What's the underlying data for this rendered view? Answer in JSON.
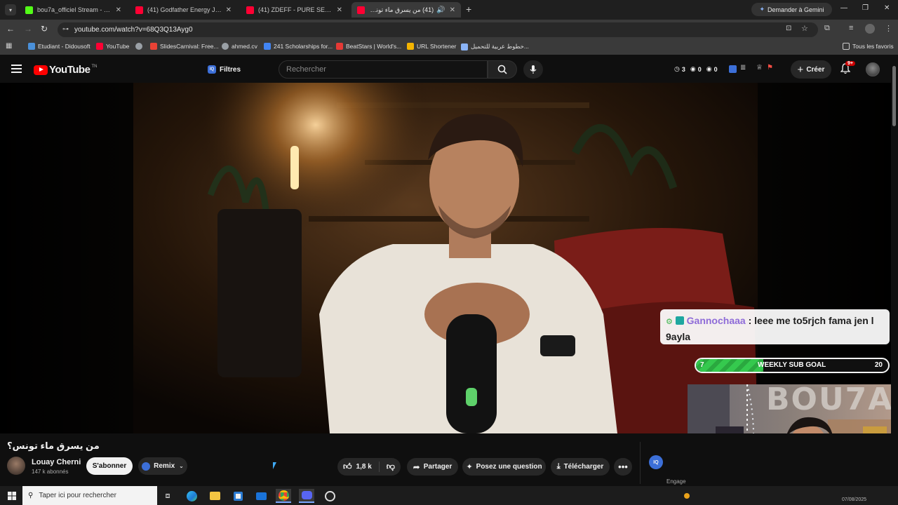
{
  "browser": {
    "tabs": [
      {
        "title": "bou7a_officiel Stream - Watch Li",
        "favicon_color": "#53fc18",
        "active": false
      },
      {
        "title": "(41) Godfather Energy Jazz | Old",
        "favicon_color": "#ff0033",
        "active": false
      },
      {
        "title": "(41) ZDEFF - PURE SESSION (Lo",
        "favicon_color": "#ff0033",
        "active": false
      },
      {
        "title": "(41) من يسرق ماء تونس؟ - ",
        "favicon_color": "#ff0033",
        "active": true
      }
    ],
    "gemini_label": "Demander à Gemini",
    "url": "youtube.com/watch?v=68Q3Q13Ayg0",
    "bookmarks": [
      {
        "label": "Etudiant - Didousoft",
        "color": "#4a90d9"
      },
      {
        "label": "YouTube",
        "color": "#ff0033"
      },
      {
        "label": "",
        "color": "#9aa0a6"
      },
      {
        "label": "SlidesCarnival: Free...",
        "color": "#e94235"
      },
      {
        "label": "ahmed.cv",
        "color": "#9aa0a6"
      },
      {
        "label": "241 Scholarships for...",
        "color": "#4285f4"
      },
      {
        "label": "BeatStars | World's...",
        "color": "#e53935"
      },
      {
        "label": "URL Shortener",
        "color": "#f4b400"
      },
      {
        "label": "خطوط عربية للتحميل...",
        "color": "#8ab4f8"
      }
    ],
    "all_bookmarks_label": "Tous les favoris"
  },
  "youtube": {
    "logo_text": "YouTube",
    "logo_region": "TN",
    "filters_label": "Filtres",
    "search_placeholder": "Rechercher",
    "ext_counts": [
      "3",
      "0",
      "0"
    ],
    "create_label": "Créer",
    "notif_badge": "9+"
  },
  "video": {
    "title": "من يسرق ماء تونس؟",
    "channel": "Louay Cherni",
    "subscribers": "147 k abonnés",
    "subscribe_label": "S'abonner",
    "remix_label": "Remix",
    "likes": "1,8 k",
    "share_label": "Partager",
    "ask_label": "Posez une question",
    "download_label": "Télécharger",
    "engage_partial": "Engage"
  },
  "overlay": {
    "chat_user": "Gannochaaa",
    "chat_message": "leee me to5rjch fama jen l 9ayla",
    "goal_current": "7",
    "goal_label": "WEEKLY SUB GOAL",
    "goal_target": "20",
    "goal_progress": 0.35,
    "cam_banner": "BOU7A"
  },
  "taskbar": {
    "search_placeholder": "Taper ici pour rechercher",
    "date_partial": "07/08/2025"
  },
  "colors": {
    "yt_red": "#ff0000",
    "goal_green": "#39d353",
    "chat_user": "#8e6bd8"
  }
}
